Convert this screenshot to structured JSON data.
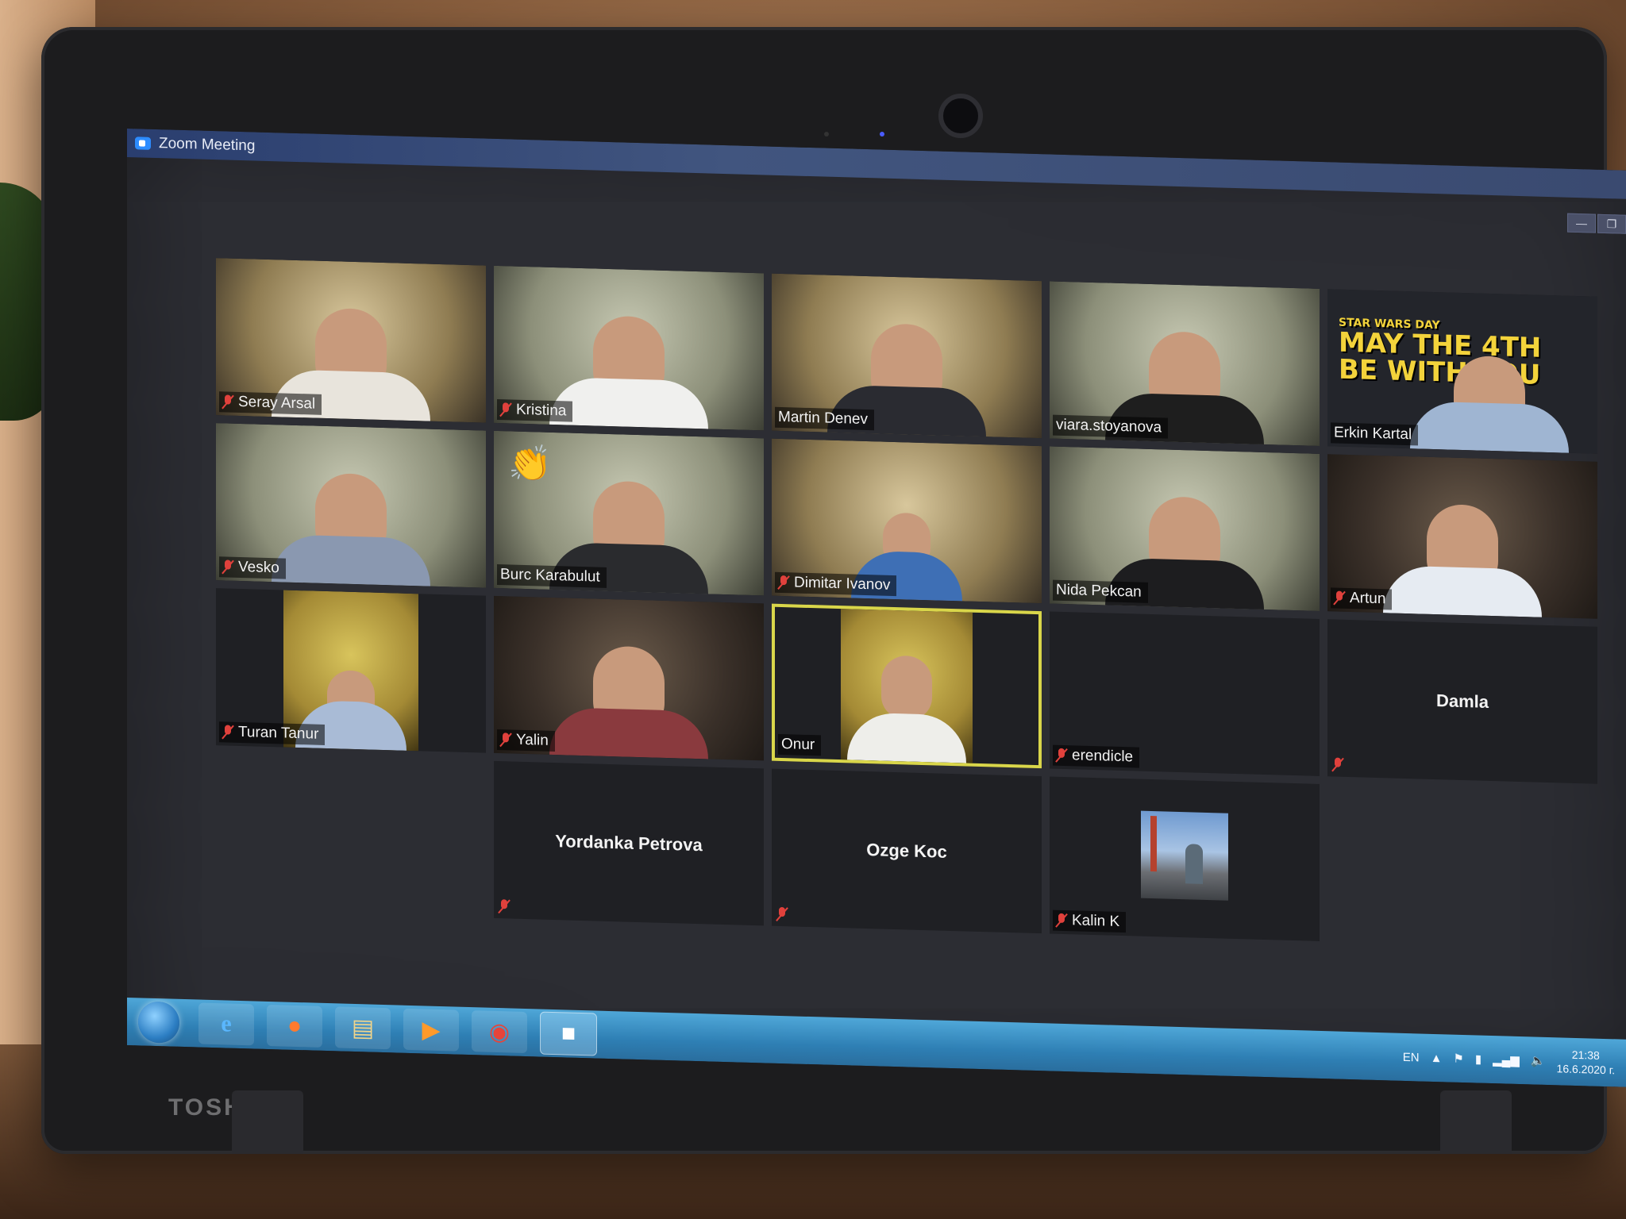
{
  "window": {
    "title": "Zoom Meeting"
  },
  "window_controls": {
    "minimize": "—",
    "restore": "❐"
  },
  "participants": [
    {
      "name": "Seray Arsal",
      "muted": true,
      "video": "warm"
    },
    {
      "name": "Kristina",
      "muted": true,
      "video": "cool"
    },
    {
      "name": "Martin Denev",
      "muted": false,
      "video": "warm"
    },
    {
      "name": "viara.stoyanova",
      "muted": false,
      "video": "cool"
    },
    {
      "name": "Erkin Kartal",
      "muted": false,
      "video": "star"
    },
    {
      "name": "Vesko",
      "muted": true,
      "video": "cool"
    },
    {
      "name": "Burc Karabulut",
      "muted": false,
      "video": "cool",
      "reaction": "👏"
    },
    {
      "name": "Dimitar Ivanov",
      "muted": true,
      "video": "warm"
    },
    {
      "name": "Nida Pekcan",
      "muted": false,
      "video": "cool"
    },
    {
      "name": "Artun",
      "muted": true,
      "video": "dark"
    },
    {
      "name": "Turan Tanur",
      "muted": true,
      "video": "yellow"
    },
    {
      "name": "Yalin",
      "muted": true,
      "video": "dark"
    },
    {
      "name": "Onur",
      "muted": false,
      "video": "yellow",
      "active_speaker": true
    },
    {
      "name": "erendicle",
      "muted": true,
      "video": "off"
    },
    {
      "name": "Damla",
      "muted": true,
      "video": "off"
    },
    {
      "name": "Yordanka Petrova",
      "muted": true,
      "video": "off"
    },
    {
      "name": "Ozge Koc",
      "muted": true,
      "video": "off"
    },
    {
      "name": "Kalin K",
      "muted": true,
      "video": "avatar"
    }
  ],
  "star_wars": {
    "line1": "STAR WARS DAY",
    "line2": "MAY THE 4TH",
    "line3": "BE WITH YOU"
  },
  "taskbar": {
    "apps": [
      "start-orb",
      "internet-explorer",
      "firefox",
      "file-explorer",
      "media-player",
      "chrome",
      "zoom"
    ],
    "language": "EN",
    "time": "21:38",
    "date": "16.6.2020 г."
  },
  "laptop": {
    "brand": "TOSHIBA"
  },
  "colors": {
    "active_speaker_border": "#d9d64a",
    "muted_red": "#e0413c",
    "taskbar_blue": "#2e7fb4"
  }
}
